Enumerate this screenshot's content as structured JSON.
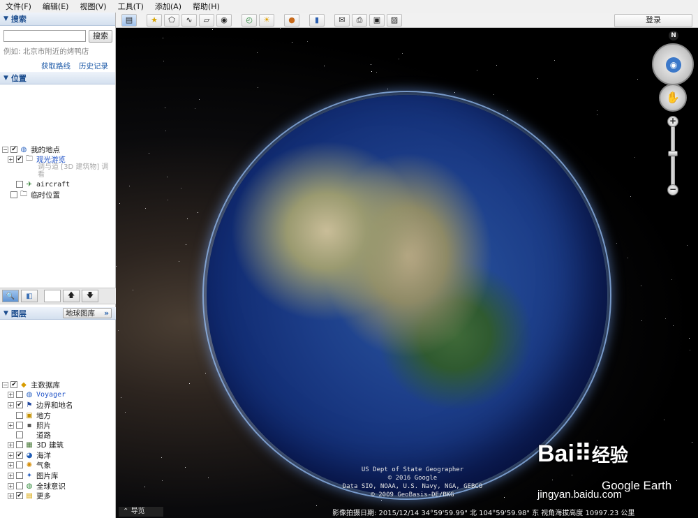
{
  "menu": [
    "文件(F)",
    "编辑(E)",
    "视图(V)",
    "工具(T)",
    "添加(A)",
    "帮助(H)"
  ],
  "toolbar": {
    "login_label": "登录"
  },
  "search": {
    "header": "搜索",
    "placeholder": "",
    "button_label": "搜索",
    "hint": "例如: 北京市附近的烤鸭店",
    "link_directions": "获取路线",
    "link_history": "历史记录"
  },
  "places": {
    "header": "位置",
    "items": [
      {
        "label": "我的地点"
      },
      {
        "label": "观光游览"
      },
      {
        "label": "调与道  [3D 建筑物]  调看"
      },
      {
        "label": "aircraft"
      },
      {
        "label": "临时位置"
      }
    ]
  },
  "layers": {
    "header": "图层",
    "gallery_label": "地球图库",
    "gallery_arrow": "»",
    "items": [
      {
        "label": "主数据库"
      },
      {
        "label": "Voyager"
      },
      {
        "label": "边界和地名"
      },
      {
        "label": "地方"
      },
      {
        "label": "照片"
      },
      {
        "label": "道路"
      },
      {
        "label": "3D 建筑"
      },
      {
        "label": "海洋"
      },
      {
        "label": "气象"
      },
      {
        "label": "图片库"
      },
      {
        "label": "全球意识"
      },
      {
        "label": "更多"
      }
    ]
  },
  "viewport": {
    "compass_n": "N",
    "credits": [
      "US Dept of State Geographer",
      "© 2016 Google",
      "Data SIO, NOAA, U.S. Navy, NGA, GEBCO",
      "© 2009 GeoBasis-DE/BKG"
    ],
    "nav_label": "导览",
    "status_text": "影像拍摄日期: 2015/12/14   34°59'59.99\" 北  104°59'59.98\" 东  视角海拔高度 10997.23 公里",
    "ge_logo": "Google Earth",
    "baidu_logo": "Bai",
    "baidu_logo_2": "经验",
    "baidu_url": "jingyan.baidu.com"
  }
}
